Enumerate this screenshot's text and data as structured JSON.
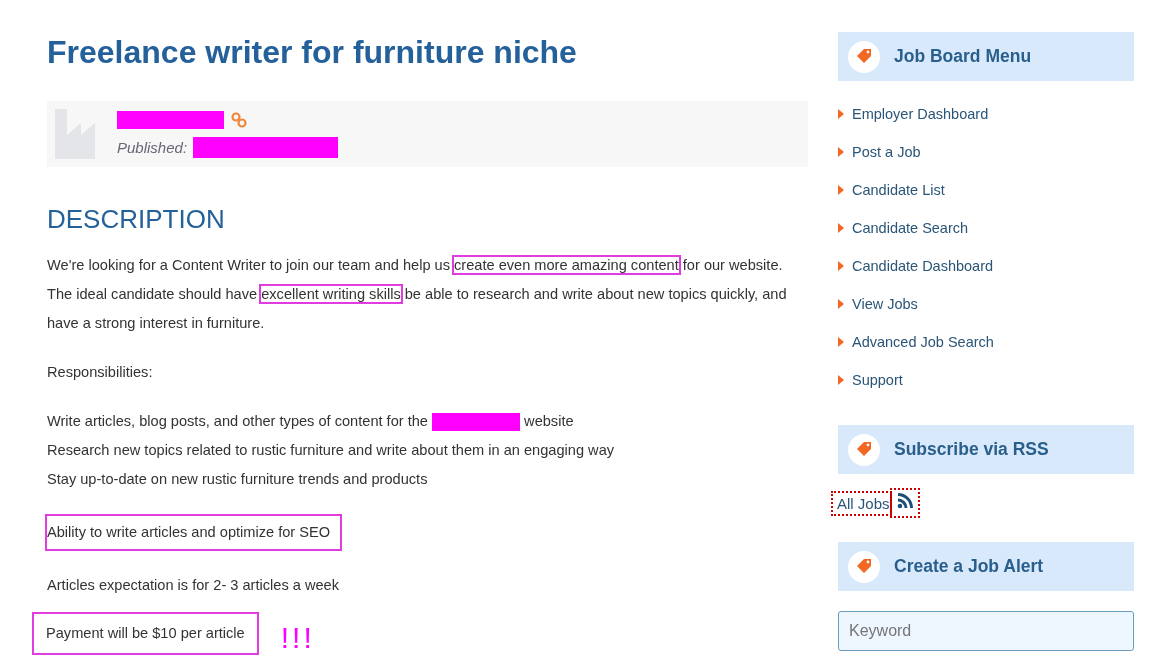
{
  "job": {
    "title": "Freelance writer for furniture niche",
    "published_label": "Published:"
  },
  "description": {
    "heading": "DESCRIPTION",
    "blocks": [
      {
        "kind": "paragraph",
        "boxed": false,
        "segments": [
          {
            "text": "We're looking for a Content Writer to join our team and help us ",
            "highlighted": false
          },
          {
            "text": "create even more amazing content",
            "highlighted": true
          },
          {
            "text": " for our website. The ideal candidate should have ",
            "highlighted": false
          },
          {
            "text": "excellent writing skills",
            "highlighted": true
          },
          {
            "text": " be able to research and write about new topics quickly, and have a strong interest in furniture.",
            "highlighted": false
          }
        ]
      },
      {
        "kind": "paragraph",
        "boxed": false,
        "segments": [
          {
            "text": "Responsibilities:",
            "highlighted": false
          }
        ]
      },
      {
        "kind": "lines",
        "lines": [
          {
            "segments": [
              {
                "kind": "text",
                "text": "Write articles, blog posts, and other types of content for the "
              },
              {
                "kind": "redacted"
              },
              {
                "kind": "text",
                "text": " website"
              }
            ]
          },
          {
            "segments": [
              {
                "kind": "text",
                "text": "Research new topics related to rustic furniture and write about them in an engaging way"
              }
            ]
          },
          {
            "segments": [
              {
                "kind": "text",
                "text": "Stay up-to-date on new rustic furniture trends and products"
              }
            ]
          }
        ]
      },
      {
        "kind": "paragraph",
        "boxed": true,
        "segments": [
          {
            "text": "Ability to write articles and optimize for SEO",
            "highlighted": false
          }
        ]
      },
      {
        "kind": "paragraph",
        "boxed": false,
        "segments": [
          {
            "text": "Articles expectation is for 2- 3 articles a week",
            "highlighted": false
          }
        ]
      },
      {
        "kind": "paragraph",
        "boxed": true,
        "segments": [
          {
            "text": "Payment will be $10 per article",
            "highlighted": false
          }
        ],
        "note": "!!!"
      }
    ]
  },
  "sidebar": [
    {
      "kind": "menu",
      "title": "Job Board Menu",
      "items": [
        "Employer Dashboard",
        "Post a Job",
        "Candidate List",
        "Candidate Search",
        "Candidate Dashboard",
        "View Jobs",
        "Advanced Job Search",
        "Support"
      ]
    },
    {
      "kind": "rss",
      "title": "Subscribe via RSS",
      "link": {
        "label": "All Jobs",
        "outlined": true
      },
      "feed_icon": {
        "outlined": true
      }
    },
    {
      "kind": "form",
      "title": "Create a Job Alert",
      "fields": [
        {
          "placeholder": "Keyword"
        }
      ]
    }
  ]
}
